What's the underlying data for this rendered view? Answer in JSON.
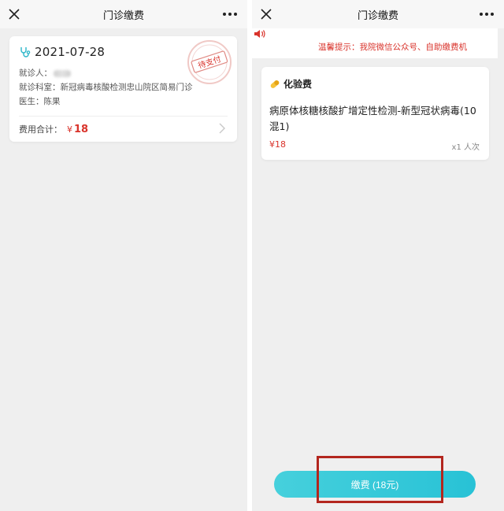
{
  "left": {
    "topbar": {
      "title": "门诊缴费",
      "close_icon": "close-icon",
      "more_icon": "more-icon"
    },
    "visit": {
      "date": "2021-07-28",
      "patient_label": "就诊人：",
      "department_label": "就诊科室：",
      "department": "新冠病毒核酸检测忠山院区简易门诊",
      "doctor_label": "医生：",
      "doctor": "陈果",
      "total_label": "费用合计：",
      "currency": "¥",
      "total": "18",
      "stamp_text": "待支付"
    }
  },
  "right": {
    "topbar": {
      "title": "门诊缴费",
      "close_icon": "close-icon",
      "more_icon": "more-icon"
    },
    "notice": "温馨提示：我院微信公众号、自助缴费机",
    "item": {
      "category": "化验费",
      "name": "病原体核糖核酸扩增定性检测-新型冠状病毒(10混1)",
      "price": "¥18",
      "quantity": "x1 人次"
    },
    "pay_button": "缴费 (18元)"
  },
  "colors": {
    "accent_red": "#d9332b",
    "button_cyan": "#28c2d6",
    "highlight_box": "#b3261e"
  }
}
